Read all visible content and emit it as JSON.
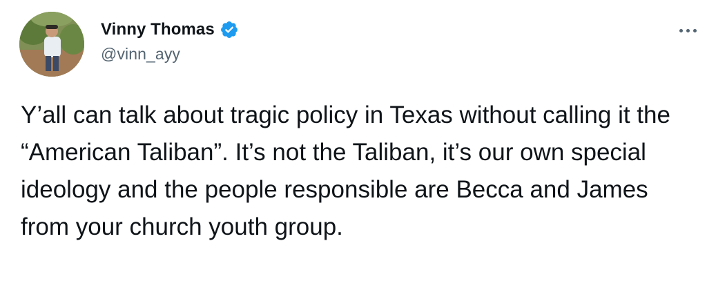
{
  "tweet": {
    "author": {
      "display_name": "Vinny Thomas",
      "handle": "@vinn_ayy",
      "verified": true,
      "avatar_icon": "avatar-photo-icon"
    },
    "more_icon": "more-options-icon",
    "text": "Y’all can talk about tragic policy in Texas without calling it the “American Taliban”. It’s not the Taliban, it’s our own special ideology and the people responsible are Becca and James from your church youth group."
  },
  "colors": {
    "text_primary": "#0f1419",
    "text_secondary": "#536471",
    "verified_blue": "#1d9bf0",
    "background": "#ffffff"
  }
}
